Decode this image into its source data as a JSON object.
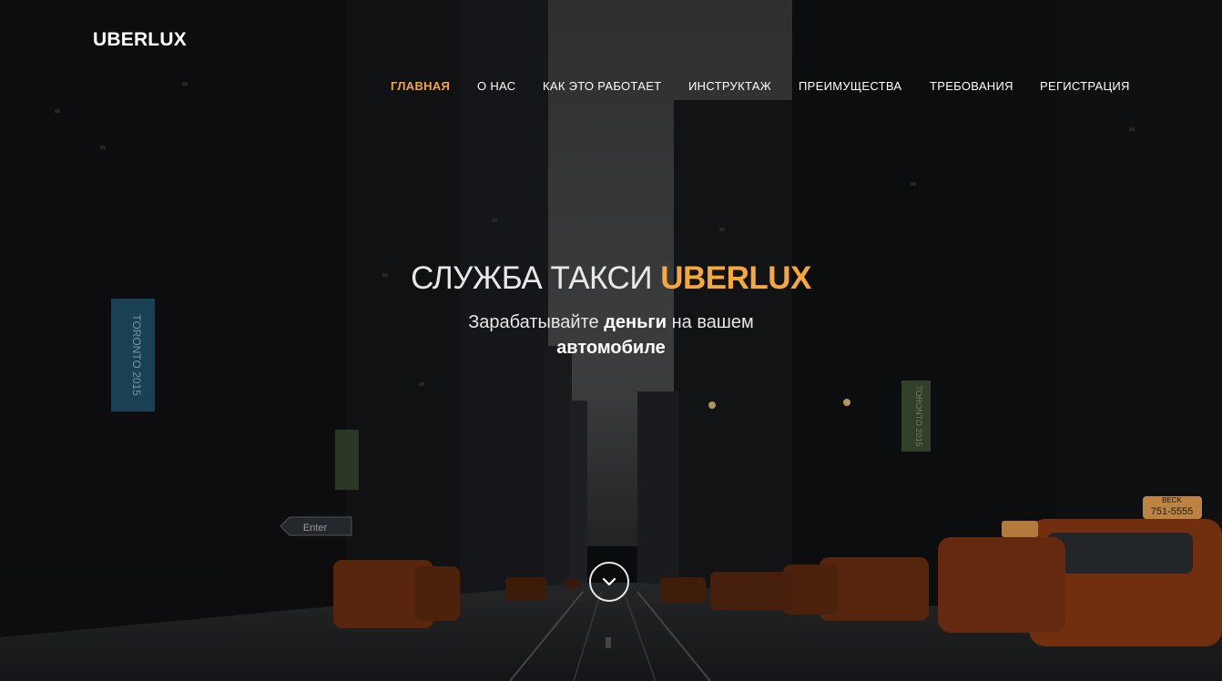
{
  "brand": {
    "logo_text": "UBERLUX"
  },
  "nav": {
    "items": [
      {
        "label": "ГЛАВНАЯ",
        "active": true
      },
      {
        "label": "О НАС",
        "active": false
      },
      {
        "label": "КАК ЭТО РАБОТАЕТ",
        "active": false
      },
      {
        "label": "ИНСТРУКТАЖ",
        "active": false
      },
      {
        "label": "ПРЕИМУЩЕСТВА",
        "active": false
      },
      {
        "label": "ТРЕБОВАНИЯ",
        "active": false
      },
      {
        "label": "РЕГИСТРАЦИЯ",
        "active": false
      }
    ]
  },
  "hero": {
    "title_prefix": "СЛУЖБА ТАКСИ",
    "title_accent": "UBERLUX",
    "subtitle_part1": "Зарабатывайте",
    "subtitle_bold1": "деньги",
    "subtitle_part2": "на вашем",
    "subtitle_bold2": "автомобиле",
    "background": "dark city street with taxis",
    "scroll_icon": "chevron-down-icon",
    "banner_left_text": "TORONTO 2015",
    "banner_right_text": "TORONTO 2015",
    "sign_text": "Enter",
    "taxi_sign_text": "BECK",
    "taxi_number": "751-5555"
  },
  "colors": {
    "accent": "#f6a83b",
    "nav_text": "#ffffff",
    "background": "#0c0d0f"
  }
}
